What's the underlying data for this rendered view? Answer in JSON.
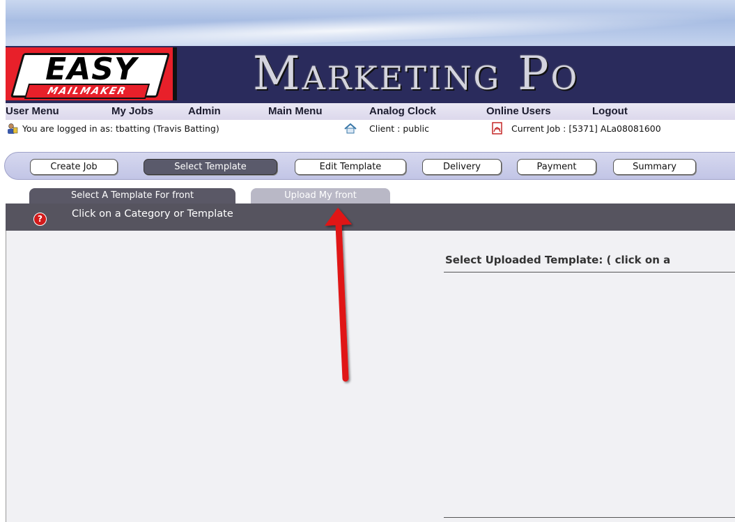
{
  "logo": {
    "word": "EASY",
    "subword": "MAILMAKER"
  },
  "banner": {
    "title": "Marketing Po"
  },
  "menu": {
    "items": [
      "User Menu",
      "My Jobs",
      "Admin",
      "Main Menu",
      "Analog Clock",
      "Online Users",
      "Logout"
    ]
  },
  "info": {
    "logged_in": "You are logged in as: tbatting (Travis Batting)",
    "client": "Client :  public",
    "current_job": "Current Job : [5371] ALa08081600"
  },
  "steps": {
    "items": [
      "Create Job",
      "Select Template",
      "Edit Template",
      "Delivery",
      "Payment",
      "Summary"
    ],
    "active": "Select Template"
  },
  "tabs": {
    "items": [
      "Select A Template For front",
      "Upload My front"
    ]
  },
  "hint": {
    "text": "Click on a Category or Template"
  },
  "main": {
    "select_label": "Select Uploaded Template: ( click on a"
  },
  "colors": {
    "banner": "#2a2b5c",
    "logo_red": "#e8202a",
    "annotation_arrow": "#e01414"
  }
}
